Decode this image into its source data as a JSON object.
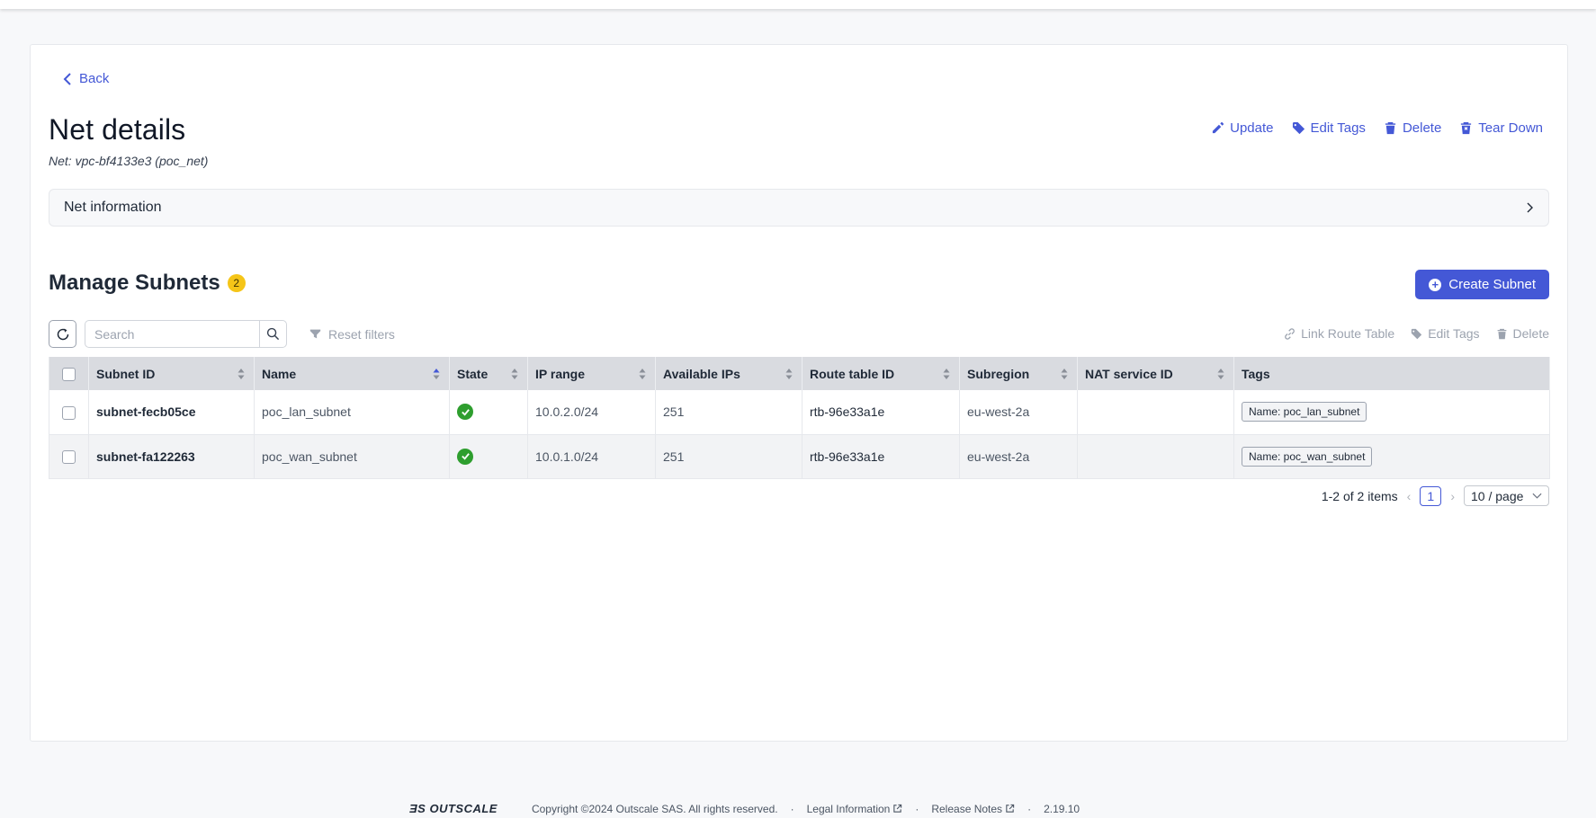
{
  "nav": {
    "back_label": "Back"
  },
  "header": {
    "title": "Net details",
    "subtitle": "Net: vpc-bf4133e3 (poc_net)",
    "actions": [
      "Update",
      "Edit Tags",
      "Delete",
      "Tear Down"
    ]
  },
  "net_info": {
    "label": "Net information"
  },
  "subnets": {
    "title": "Manage Subnets",
    "count": "2",
    "create_label": "Create Subnet",
    "search_placeholder": "Search",
    "reset_label": "Reset filters",
    "bulk_actions": [
      "Link Route Table",
      "Edit Tags",
      "Delete"
    ],
    "columns": [
      "Subnet ID",
      "Name",
      "State",
      "IP range",
      "Available IPs",
      "Route table ID",
      "Subregion",
      "NAT service ID",
      "Tags"
    ],
    "rows": [
      {
        "subnet_id": "subnet-fecb05ce",
        "name": "poc_lan_subnet",
        "state": "available",
        "ip_range": "10.0.2.0/24",
        "available_ips": "251",
        "route_table_id": "rtb-96e33a1e",
        "subregion": "eu-west-2a",
        "nat_service_id": "",
        "tag": "Name: poc_lan_subnet"
      },
      {
        "subnet_id": "subnet-fa122263",
        "name": "poc_wan_subnet",
        "state": "available",
        "ip_range": "10.0.1.0/24",
        "available_ips": "251",
        "route_table_id": "rtb-96e33a1e",
        "subregion": "eu-west-2a",
        "nat_service_id": "",
        "tag": "Name: poc_wan_subnet"
      }
    ],
    "pagination": {
      "summary": "1-2 of 2 items",
      "current_page": "1",
      "page_size": "10 / page"
    }
  },
  "footer": {
    "logo": "OUTSCALE",
    "copyright": "Copyright ©2024 Outscale SAS. All rights reserved.",
    "legal": "Legal Information",
    "release_notes": "Release Notes",
    "version": "2.19.10"
  },
  "colors": {
    "accent": "#4458d6",
    "badge": "#f5c518",
    "success": "#2e9e2e"
  }
}
